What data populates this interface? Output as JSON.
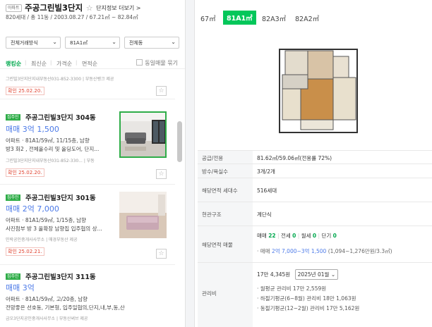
{
  "header": {
    "type_badge": "아파트",
    "apt_name": "주공그린빌3단지",
    "info_link": "단지정보 더보기 >",
    "sub_info": "820세대 / 총 11동 / 2003.08.27 / 67.21㎡ ~ 82.84㎡"
  },
  "filters": [
    {
      "label": "전체거래방식"
    },
    {
      "label": "81A1㎡"
    },
    {
      "label": "전체동"
    }
  ],
  "sort": {
    "items": [
      "랭킹순",
      "최신순",
      "가격순",
      "면적순"
    ],
    "active": "랭킹순",
    "same_listing": "동일매물 묶기"
  },
  "listings": [
    {
      "status": "",
      "title": "",
      "price": "",
      "spec": "",
      "desc": "",
      "agency": "그린빌3단지단지내부동산031-852-3300 | 부동산뱅크 제공",
      "confirm": "확인 25.02.20."
    },
    {
      "status": "집주인",
      "title": "주공그린빌3단지 304동",
      "price": "매매 3억 1,500",
      "spec": "아파트 · 81A1/59㎡, 11/15층, 남향",
      "desc": "방3 화2 , 전체올수리 및 올딩도어, 단지...",
      "agency": "그린빌3단지단지내부동산031-852-330... | 부동",
      "confirm": "확인 25.02.20."
    },
    {
      "status": "집주인",
      "title": "주공그린빌3단지 301동",
      "price": "매매 2억 7,000",
      "spec": "아파트 · 81A1/59㎡, 1/15층, 남향",
      "desc": "사진첨부 방 3 올확장 남향집 입주협의 상...",
      "agency": "민락공인중개사사무소 | 매경부동산 제공",
      "confirm": "확인 25.02.21."
    },
    {
      "status": "집주인",
      "title": "주공그린빌3단지 311동",
      "price": "매매 3억",
      "spec": "아파트 · 81A1/59㎡, 고/20층, 남향",
      "desc": "전망좋은 선호동, 기본형, 입주일협의,단지,내,부,동,산",
      "agency": "금오3단지공인중개사사무소 | 부동산써브 제공",
      "confirm": ""
    }
  ],
  "area_tabs": [
    "67㎡",
    "81A1㎡",
    "82A3㎡",
    "82A2㎡"
  ],
  "active_area": "81A1㎡",
  "details": {
    "supply_label": "공급/전용",
    "supply_value": "81.62㎡/59.06㎡(전용률 72%)",
    "rooms_label": "방수/욕실수",
    "rooms_value": "3개/2개",
    "households_label": "해당면적 세대수",
    "households_value": "516세대",
    "entrance_label": "현관구조",
    "entrance_value": "계단식",
    "listings_label": "해당면적 매물",
    "sale_label": "매매",
    "sale_count": "22",
    "jeonse_label": "전세",
    "jeonse_count": "0",
    "wolse_label": "월세",
    "wolse_count": "0",
    "short_label": "단기",
    "short_count": "0",
    "price_range_prefix": "· 매매",
    "price_range": "2억 7,000~3억 1,500",
    "price_range_suffix": "(1,094~1,276만원/3.3㎡)",
    "maint_label": "관리비",
    "maint_total": "17만 4,345원",
    "maint_month": "2025년 01월",
    "maint_avg": "· 월평균 관리비 17만 2,559원",
    "maint_summer": "· 하절기평균(6~8월) 관리비 18만 1,063원",
    "maint_winter": "· 동절기평균(12~2월) 관리비 17만 5,162원"
  },
  "colors": {
    "accent_green": "#03c75a",
    "price_blue": "#4c7ae8",
    "confirm_red": "#e0412e"
  }
}
